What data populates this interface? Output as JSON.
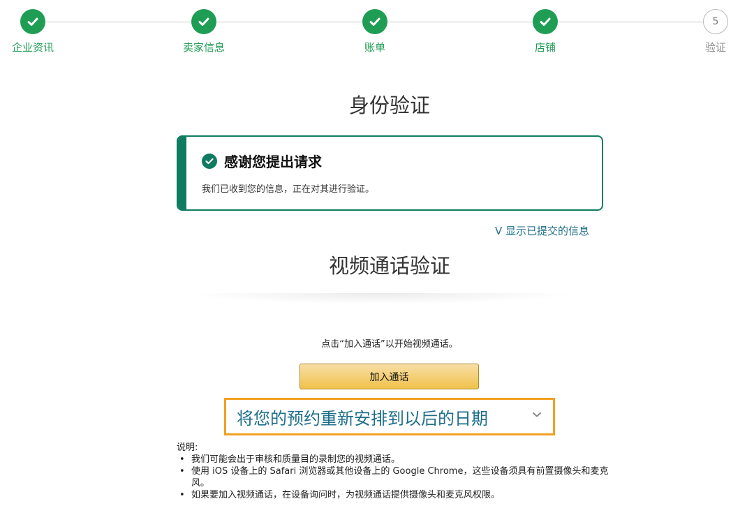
{
  "stepper": {
    "steps": [
      {
        "label": "企业资讯",
        "status": "done"
      },
      {
        "label": "卖家信息",
        "status": "done"
      },
      {
        "label": "账单",
        "status": "done"
      },
      {
        "label": "店铺",
        "status": "done"
      },
      {
        "label": "验证",
        "status": "current",
        "number": "5"
      }
    ]
  },
  "page_title": "身份验证",
  "alert": {
    "icon": "check-circle-icon",
    "heading": "感谢您提出请求",
    "body": "我们已收到您的信息，正在对其进行验证。"
  },
  "show_info_link": "V 显示已提交的信息",
  "video_section": {
    "title": "视频通话验证",
    "hint": "点击“加入通话”以开始视频通话。",
    "join_button": "加入通话",
    "reschedule_label": "将您的预约重新安排到以后的日期"
  },
  "notes": {
    "heading": "说明:",
    "items": [
      "我们可能会出于审核和质量目的录制您的视频通话。",
      "使用 iOS 设备上的 Safari 浏览器或其他设备上的 Google Chrome，这些设备须具有前置摄像头和麦克风。",
      "如果要加入视频通话，在设备询问时，为视频通话提供摄像头和麦克风权限。"
    ]
  },
  "colors": {
    "step_done": "#1f9d55",
    "alert_border": "#0f7b61",
    "link": "#1f6f8b",
    "button_fill": "#f0c14b",
    "highlight_border": "#f0a020"
  }
}
